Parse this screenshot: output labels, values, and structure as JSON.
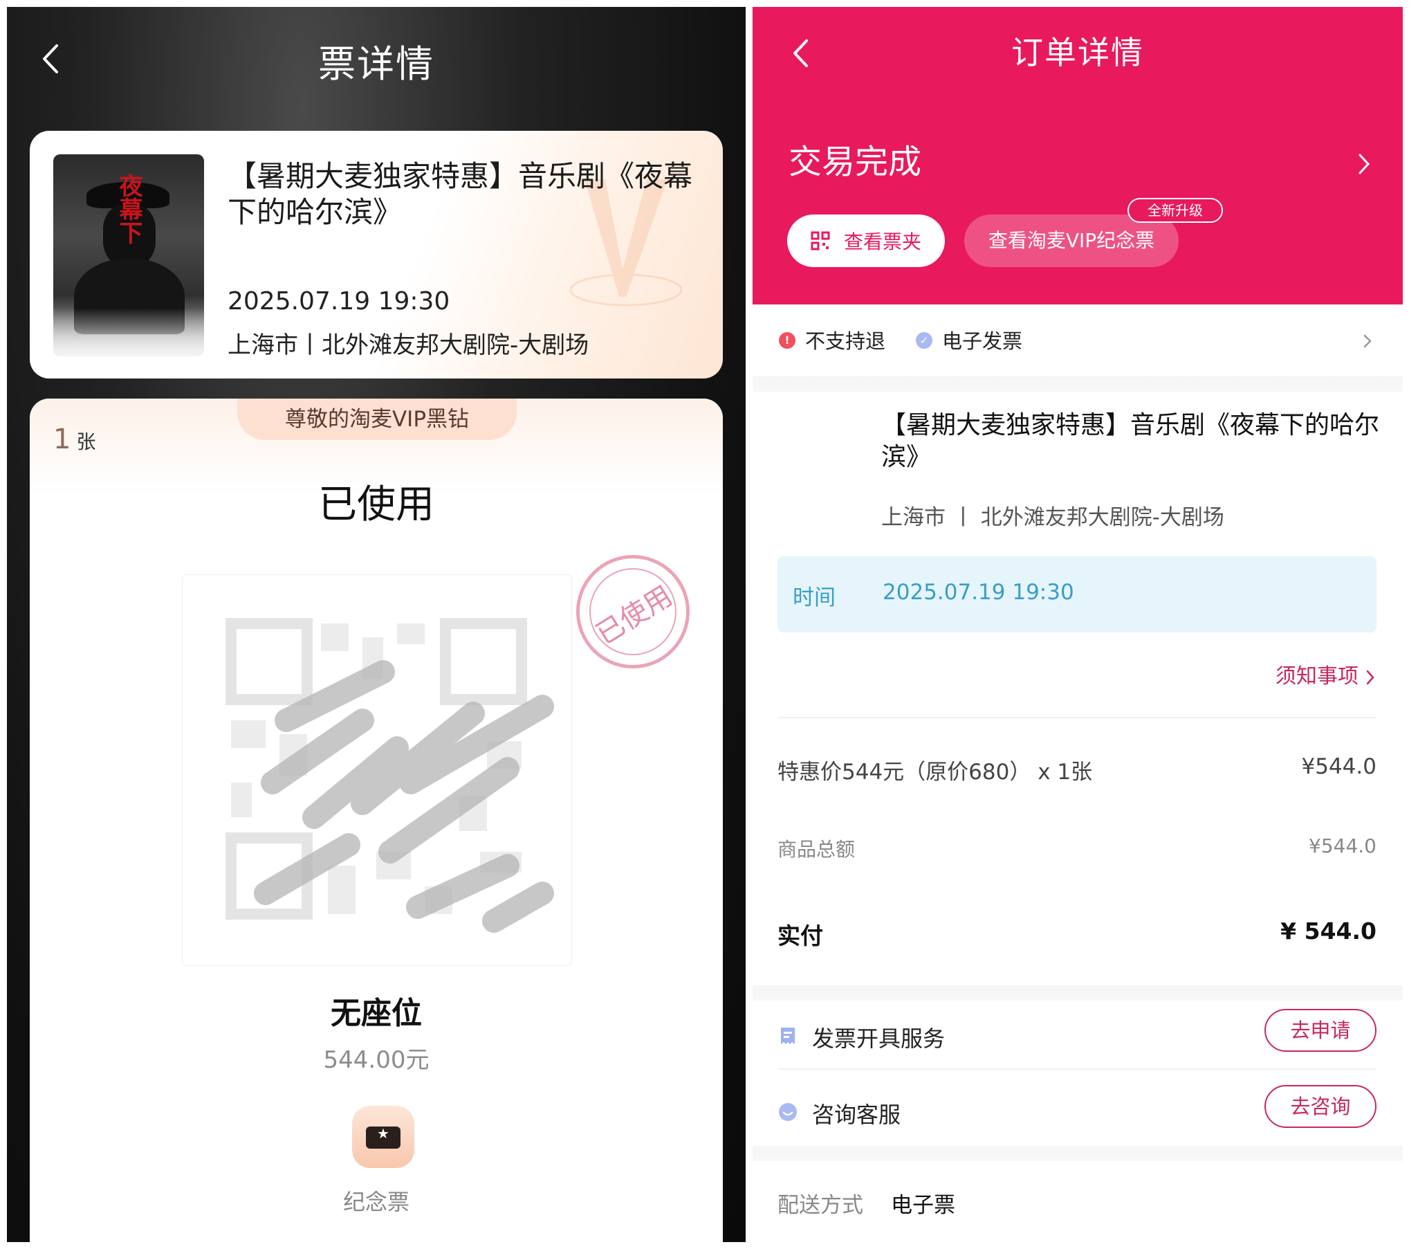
{
  "left": {
    "title": "票详情",
    "event": {
      "title": "【暑期大麦独家特惠】音乐剧《夜幕下的哈尔滨》",
      "datetime": "2025.07.19 19:30",
      "venue": "上海市丨北外滩友邦大剧院-大剧场"
    },
    "ticket": {
      "member_tag": "尊敬的淘麦VIP黑钻",
      "count": "1",
      "count_unit": "张",
      "status": "已使用",
      "stamp_text": "已使用",
      "seat": "无座位",
      "price": "544.00元",
      "souvenir_label": "纪念票"
    }
  },
  "right": {
    "title": "订单详情",
    "status": "交易完成",
    "buttons": {
      "wallet": "查看票夹",
      "vip_souvenir": "查看淘麦VIP纪念票",
      "new_badge": "全新升级"
    },
    "policy": {
      "refund": "不支持退",
      "refund_icon": "!",
      "invoice": "电子发票"
    },
    "show": {
      "title": "【暑期大麦独家特惠】音乐剧《夜幕下的哈尔滨》",
      "venue": "上海市 丨 北外滩友邦大剧院-大剧场",
      "time_label": "时间",
      "time_value": "2025.07.19 19:30"
    },
    "notice_link": "须知事项",
    "pricing": {
      "item_label": "特惠价544元（原价680） x 1张",
      "item_value": "¥544.0",
      "subtotal_label": "商品总额",
      "subtotal_value": "¥544.0",
      "paid_label": "实付",
      "paid_value": "¥ 544.0"
    },
    "services": [
      {
        "label": "发票开具服务",
        "action": "去申请"
      },
      {
        "label": "咨询客服",
        "action": "去咨询"
      }
    ],
    "delivery": {
      "label": "配送方式",
      "value": "电子票"
    }
  },
  "colors": {
    "brand_pink": "#e8195c",
    "link_pink": "#c8275d",
    "time_blue": "#3a9dc8"
  }
}
